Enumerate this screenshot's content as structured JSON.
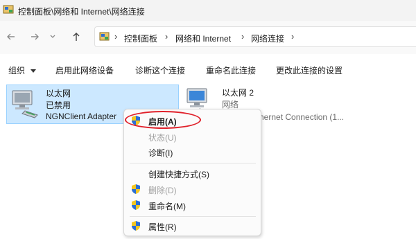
{
  "window": {
    "title": "控制面板\\网络和 Internet\\网络连接"
  },
  "address": {
    "crumbs": [
      "控制面板",
      "网络和 Internet",
      "网络连接"
    ]
  },
  "toolbar": {
    "organize": "组织",
    "enable_device": "启用此网络设备",
    "diagnose": "诊断这个连接",
    "rename": "重命名此连接",
    "change_settings": "更改此连接的设置"
  },
  "connections": [
    {
      "name": "以太网",
      "status": "已禁用",
      "device": "NGNClient Adapter"
    },
    {
      "name": "以太网 2",
      "status": "网络",
      "device": "hernet Connection (1..."
    }
  ],
  "context_menu": {
    "items": [
      {
        "label": "启用(A)",
        "bold": true,
        "shield": true,
        "enabled": true
      },
      {
        "label": "状态(U)",
        "bold": false,
        "shield": false,
        "enabled": false
      },
      {
        "label": "诊断(I)",
        "bold": false,
        "shield": false,
        "enabled": true
      },
      {
        "label": "创建快捷方式(S)",
        "bold": false,
        "shield": false,
        "enabled": true
      },
      {
        "label": "删除(D)",
        "bold": false,
        "shield": true,
        "enabled": false
      },
      {
        "label": "重命名(M)",
        "bold": false,
        "shield": true,
        "enabled": true
      },
      {
        "label": "属性(R)",
        "bold": false,
        "shield": true,
        "enabled": true
      }
    ]
  },
  "colors": {
    "highlight_circle": "#e0202a",
    "selected_bg": "#cce8ff"
  }
}
